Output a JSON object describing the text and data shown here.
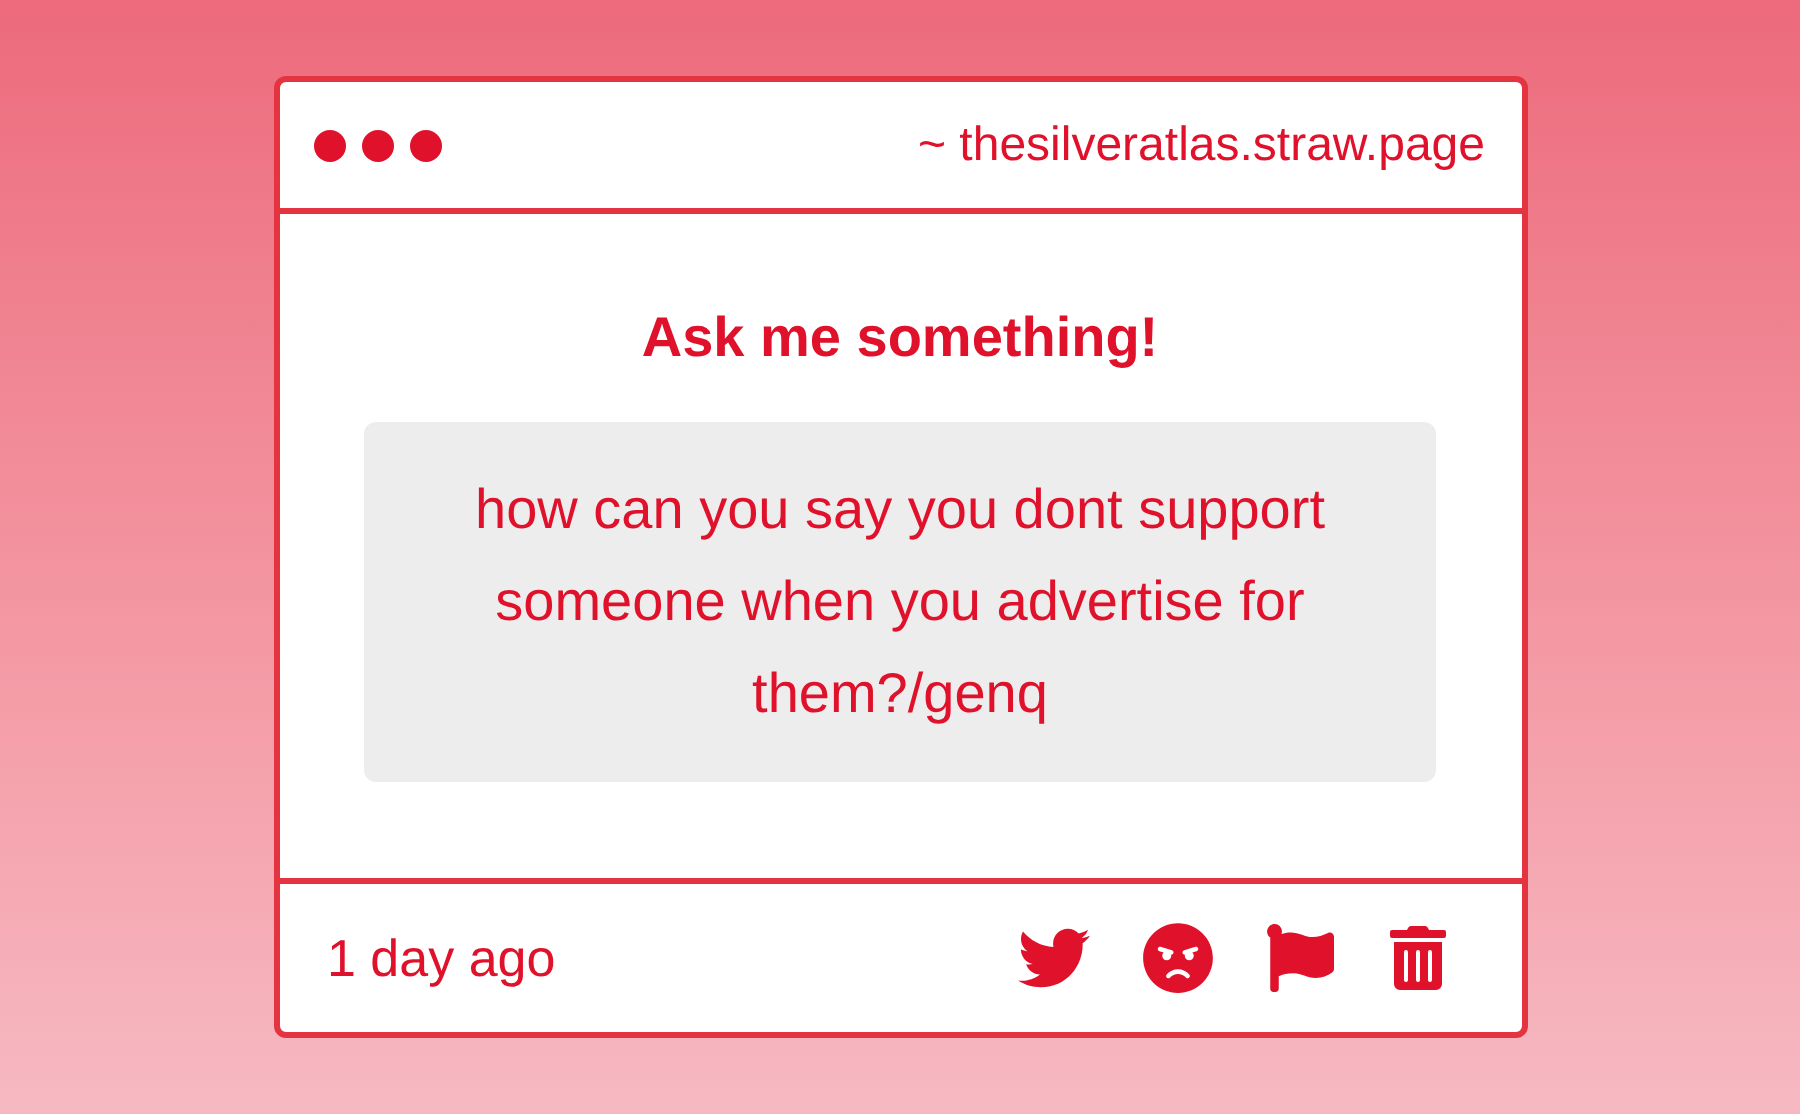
{
  "window": {
    "title": "~ thesilveratlas.straw.page"
  },
  "prompt": "Ask me something!",
  "question": "how can you say you dont support someone when you advertise for them?/genq",
  "footer": {
    "time": "1 day ago"
  }
}
